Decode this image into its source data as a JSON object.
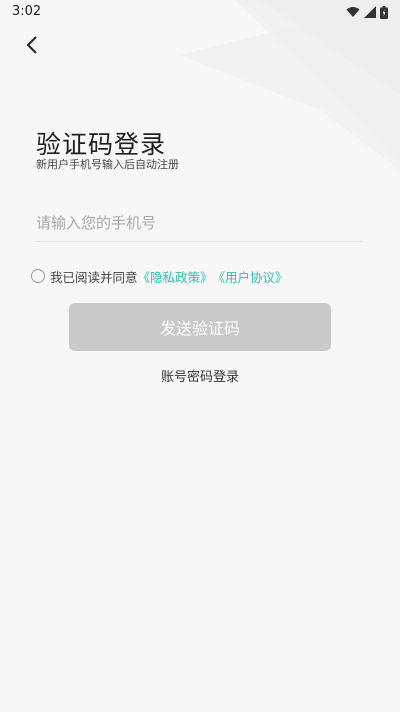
{
  "status_bar": {
    "time": "3:02"
  },
  "page": {
    "title": "验证码登录",
    "subtitle": "新用户手机号输入后自动注册"
  },
  "phone_input": {
    "placeholder": "请输入您的手机号",
    "value": ""
  },
  "agreement": {
    "prefix": "我已阅读并同意",
    "privacy_link": "《隐私政策》",
    "user_link": "《用户协议》",
    "checked": false
  },
  "buttons": {
    "send_code": "发送验证码",
    "account_login": "账号密码登录"
  },
  "colors": {
    "link": "#2ec0ad",
    "button_disabled": "#c9c9c9",
    "background": "#f7f7f7"
  }
}
